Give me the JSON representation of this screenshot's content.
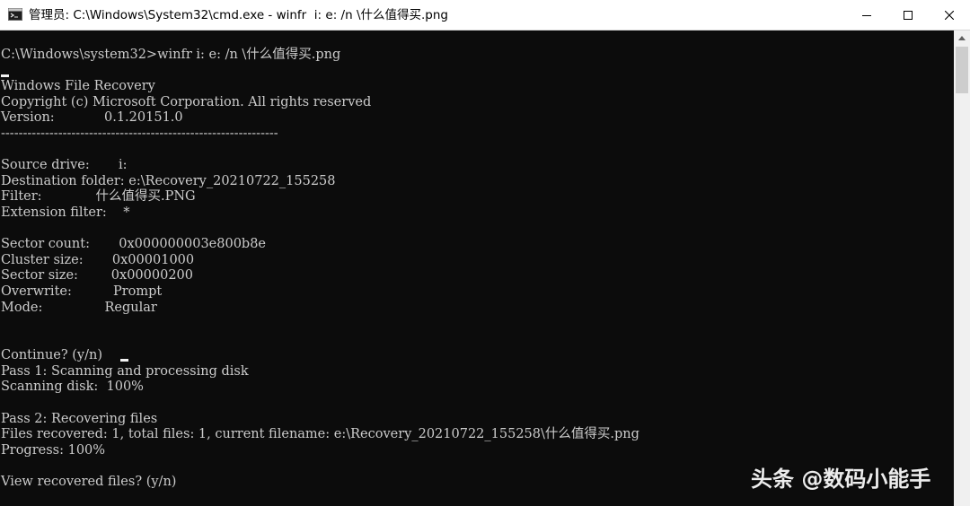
{
  "window": {
    "title": "管理员: C:\\Windows\\System32\\cmd.exe - winfr  i: e: /n \\什么值得买.png",
    "buttons": {
      "minimize_icon": "minimize-icon",
      "maximize_icon": "maximize-icon",
      "close_icon": "close-icon"
    }
  },
  "console": {
    "prompt_line": "C:\\Windows\\system32>winfr i: e: /n \\什么值得买.png",
    "header": {
      "app_name": "Windows File Recovery",
      "copyright": "Copyright (c) Microsoft Corporation. All rights reserved",
      "version": "Version:            0.1.20151.0",
      "separator": "---------------------------------------------------------------"
    },
    "settings": {
      "source_drive": "Source drive:       i:",
      "destination_folder": "Destination folder: e:\\Recovery_20210722_155258",
      "filter": "Filter:             什么值得买.PNG",
      "extension_filter": "Extension filter:    *",
      "sector_count": "Sector count:       0x000000003e800b8e",
      "cluster_size": "Cluster size:       0x00001000",
      "sector_size": "Sector size:        0x00000200",
      "overwrite": "Overwrite:          Prompt",
      "mode": "Mode:               Regular"
    },
    "progress": {
      "continue_prompt": "Continue? (y/n)",
      "pass1": "Pass 1: Scanning and processing disk",
      "scanning": "Scanning disk:  100%",
      "pass2": "Pass 2: Recovering files",
      "files_recovered": "Files recovered: 1, total files: 1, current filename: e:\\Recovery_20210722_155258\\什么值得买.png",
      "progress_line": "Progress: 100%",
      "view_prompt": "View recovered files? (y/n)"
    }
  },
  "watermark": "头条 @数码小能手"
}
